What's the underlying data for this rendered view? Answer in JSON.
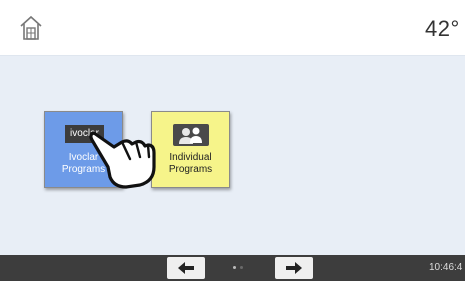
{
  "header": {
    "home_icon": "home-icon",
    "temperature": "42°"
  },
  "tiles": [
    {
      "logo_text": "ivoclar",
      "label_line1": "Ivoclar",
      "label_line2": "Programs",
      "color": "#6d9be8"
    },
    {
      "icon": "users-icon",
      "label_line1": "Individual",
      "label_line2": "Programs",
      "color": "#f6f48a"
    }
  ],
  "overlay": {
    "icon": "pointing-hand-icon"
  },
  "footer": {
    "back_icon": "arrow-left-icon",
    "forward_icon": "arrow-right-icon",
    "page_indicator": {
      "pages": 2,
      "current": 1
    },
    "time": "10:46:4"
  }
}
